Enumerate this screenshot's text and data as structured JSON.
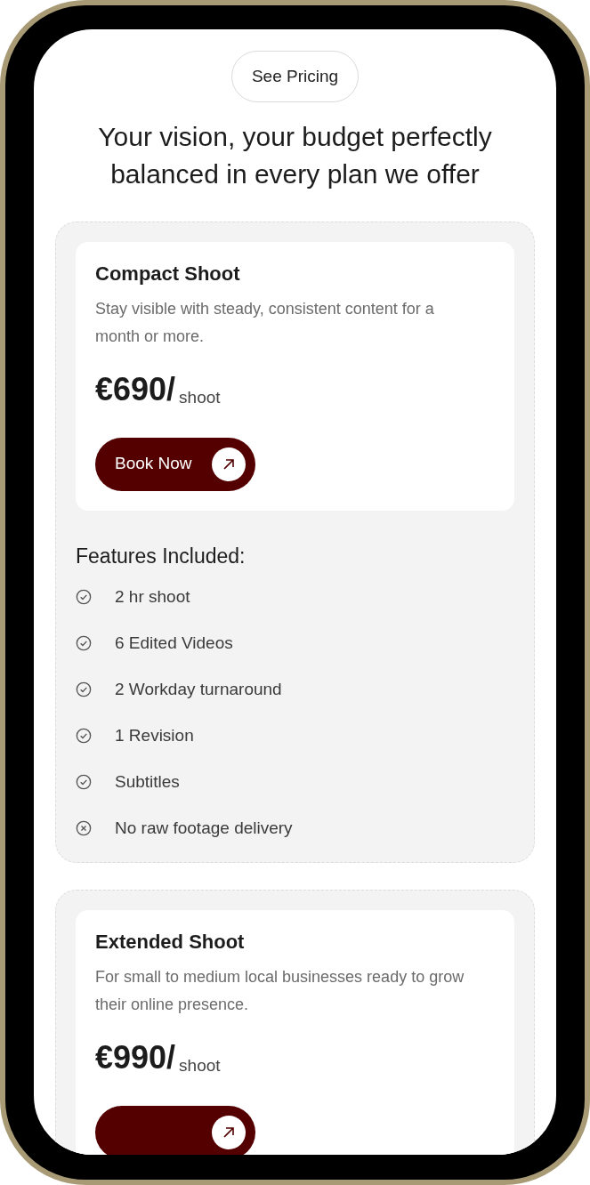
{
  "header": {
    "badge": "See Pricing",
    "title": "Your vision, your budget perfectly balanced in every plan we offer"
  },
  "plans": [
    {
      "name": "Compact Shoot",
      "description": "Stay visible with steady, consistent content for a month or more.",
      "price": "€690/",
      "unit": "shoot",
      "button": "Book Now",
      "features_title": "Features Included:",
      "features": [
        {
          "label": "2 hr shoot",
          "kind": "included"
        },
        {
          "label": "6 Edited Videos",
          "kind": "included"
        },
        {
          "label": "2 Workday turnaround",
          "kind": "included"
        },
        {
          "label": "1 Revision",
          "kind": "included"
        },
        {
          "label": "Subtitles",
          "kind": "included"
        },
        {
          "label": "No raw footage delivery",
          "kind": "excluded"
        }
      ]
    },
    {
      "name": "Extended Shoot",
      "description": "For small to medium local businesses ready to grow their online presence.",
      "price": "€990/",
      "unit": "shoot"
    }
  ]
}
